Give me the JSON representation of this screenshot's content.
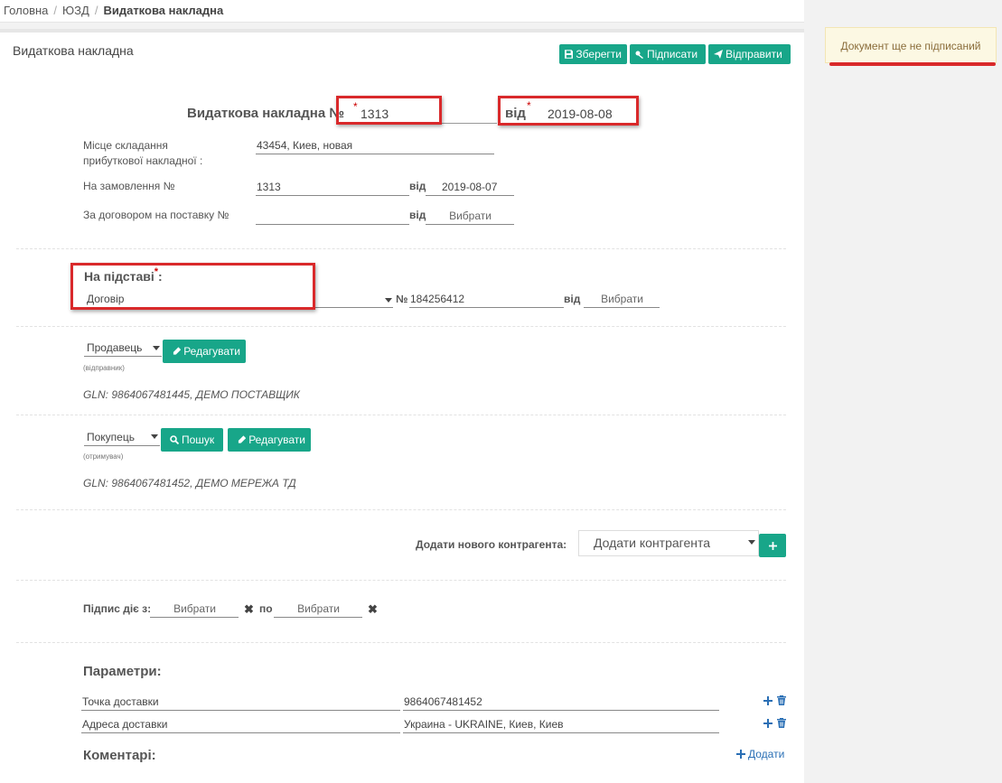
{
  "breadcrumb": {
    "home": "Головна",
    "section": "ЮЗД",
    "current": "Видаткова накладна"
  },
  "notice": {
    "text": "Документ ще не підписаний"
  },
  "panel": {
    "title": "Видаткова накладна"
  },
  "toolbar": {
    "save_label": "Зберегти",
    "sign_label": "Підписати",
    "send_label": "Відправити"
  },
  "header": {
    "doc_label": "Видаткова накладна №",
    "number": "1313",
    "date_label": "від",
    "date": "2019-08-08",
    "required_mark": "*"
  },
  "place": {
    "label_line1": "Місце складання",
    "label_line2": "прибуткової накладної :",
    "value": "43454, Киев, новая"
  },
  "order": {
    "label": "На замовлення №",
    "number": "1313",
    "date_label": "від",
    "date": "2019-08-07"
  },
  "contract": {
    "label": "За договором на поставку №",
    "number": "",
    "date_label": "від",
    "date_placeholder": "Вибрати"
  },
  "basis": {
    "label": "На підставі",
    "required_mark": "*",
    "colon": ":",
    "selected": "Договір",
    "no_label": "№",
    "number": "184256412",
    "date_label": "від",
    "date_placeholder": "Вибрати"
  },
  "seller": {
    "role": "Продавець",
    "sub": "(відправник)",
    "edit_label": "Редагувати",
    "gln": "GLN: 9864067481445, ДЕМО ПОСТАВЩИК"
  },
  "buyer": {
    "role": "Покупець",
    "sub": "(отримувач)",
    "search_label": "Пошук",
    "edit_label": "Редагувати",
    "gln": "GLN: 9864067481452, ДЕМО МЕРЕЖА ТД"
  },
  "add_contractor": {
    "label": "Додати нового контрагента:",
    "selected": "Додати контрагента"
  },
  "signature": {
    "label": "Підпис діє з:",
    "from_placeholder": "Вибрати",
    "to_label": "по",
    "to_placeholder": "Вибрати"
  },
  "params": {
    "title": "Параметри:",
    "rows": [
      {
        "name": "Точка доставки",
        "value": "9864067481452"
      },
      {
        "name": "Адреса доставки",
        "value": "Украина - UKRAINE, Киев, Киев"
      }
    ]
  },
  "comments": {
    "title": "Коментарі:",
    "add_label": "Додати"
  },
  "colors": {
    "accent": "#18a689",
    "highlight": "#d9292b",
    "notice_bg": "#fcf8e3",
    "notice_text": "#8a6d3b",
    "icon_blue": "#2a6fb5"
  }
}
